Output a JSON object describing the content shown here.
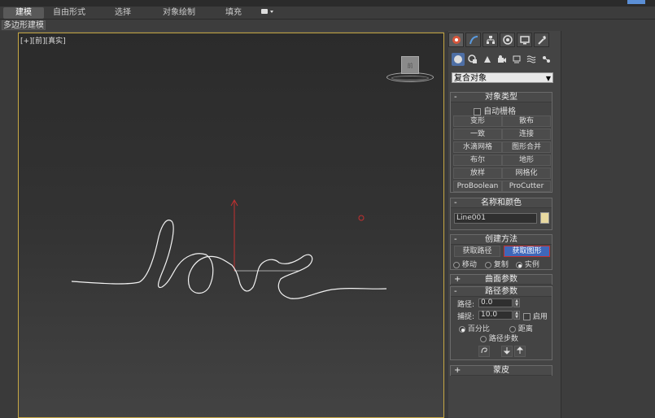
{
  "ribbon": {
    "tabs": [
      "建模",
      "自由形式",
      "选择",
      "对象绘制",
      "填充"
    ]
  },
  "subbar": {
    "label": "多边形建模"
  },
  "viewport": {
    "label_plus": "[+]",
    "label_view": "[前]",
    "label_shading": "[真实]",
    "viewcube_text": "前",
    "drawn_text": "love"
  },
  "command_panel": {
    "dropdown_value": "复合对象",
    "object_type": {
      "title": "对象类型",
      "autogrid_label": "自动栅格",
      "buttons": [
        "变形",
        "散布",
        "一致",
        "连接",
        "水滴网格",
        "图形合并",
        "布尔",
        "地形",
        "放样",
        "网格化",
        "ProBoolean",
        "ProCutter"
      ]
    },
    "name_color": {
      "title": "名称和颜色",
      "name_value": "Line001",
      "color": "#e8d9a0"
    },
    "creation_method": {
      "title": "创建方法",
      "get_path": "获取路径",
      "get_shape": "获取图形",
      "move": "移动",
      "copy": "复制",
      "instance": "实例"
    },
    "surface_params": {
      "title": "曲面参数"
    },
    "path_params": {
      "title": "路径参数",
      "path_label": "路径:",
      "path_value": "0.0",
      "snap_label": "捕捉:",
      "snap_value": "10.0",
      "enable_label": "启用",
      "percentage": "百分比",
      "distance": "距离",
      "path_steps": "路径步数"
    },
    "skin_params": {
      "title": "蒙皮"
    }
  }
}
